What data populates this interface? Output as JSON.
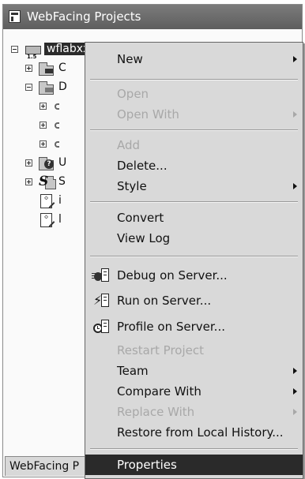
{
  "window": {
    "title": "WebFacing Projects"
  },
  "tree": {
    "root": {
      "label": "wflabxx",
      "version": "1.5"
    },
    "children": [
      {
        "label": "C",
        "icon": "folder-db-icon"
      },
      {
        "label": "D",
        "icon": "folder-table-icon"
      },
      {
        "label": "",
        "icon": "component-icon"
      },
      {
        "label": "",
        "icon": "component-icon"
      },
      {
        "label": "",
        "icon": "component-icon"
      },
      {
        "label": "U",
        "icon": "folder-help-icon"
      },
      {
        "label": "S",
        "icon": "folder-s-icon"
      },
      {
        "label": "i",
        "icon": "jsp-file-icon"
      },
      {
        "label": "l",
        "icon": "jsp-file-icon"
      }
    ]
  },
  "bottom_tab": {
    "label": "WebFacing P"
  },
  "menu": {
    "items": [
      {
        "label": "New",
        "enabled": true,
        "submenu": true
      },
      {
        "label": "Open",
        "enabled": false,
        "submenu": false
      },
      {
        "label": "Open With",
        "enabled": false,
        "submenu": true
      },
      {
        "label": "Add",
        "enabled": false,
        "submenu": false
      },
      {
        "label": "Delete...",
        "enabled": true,
        "submenu": false
      },
      {
        "label": "Style",
        "enabled": true,
        "submenu": true
      },
      {
        "label": "Convert",
        "enabled": true,
        "submenu": false
      },
      {
        "label": "View Log",
        "enabled": true,
        "submenu": false
      },
      {
        "label": "Debug on Server...",
        "enabled": true,
        "submenu": false,
        "icon": "debug-server-icon"
      },
      {
        "label": "Run on Server...",
        "enabled": true,
        "submenu": false,
        "icon": "run-server-icon"
      },
      {
        "label": "Profile on Server...",
        "enabled": true,
        "submenu": false,
        "icon": "profile-server-icon"
      },
      {
        "label": "Restart Project",
        "enabled": false,
        "submenu": false
      },
      {
        "label": "Team",
        "enabled": true,
        "submenu": true
      },
      {
        "label": "Compare With",
        "enabled": true,
        "submenu": true
      },
      {
        "label": "Replace With",
        "enabled": false,
        "submenu": true
      },
      {
        "label": "Restore from Local History...",
        "enabled": true,
        "submenu": false
      },
      {
        "label": "Properties",
        "enabled": true,
        "submenu": false,
        "highlighted": true
      }
    ]
  },
  "colors": {
    "menu_bg": "#d9d9d9",
    "highlight": "#2a2a2a",
    "disabled_text": "#a8a8a8",
    "titlebar": "#6a6a6a"
  }
}
